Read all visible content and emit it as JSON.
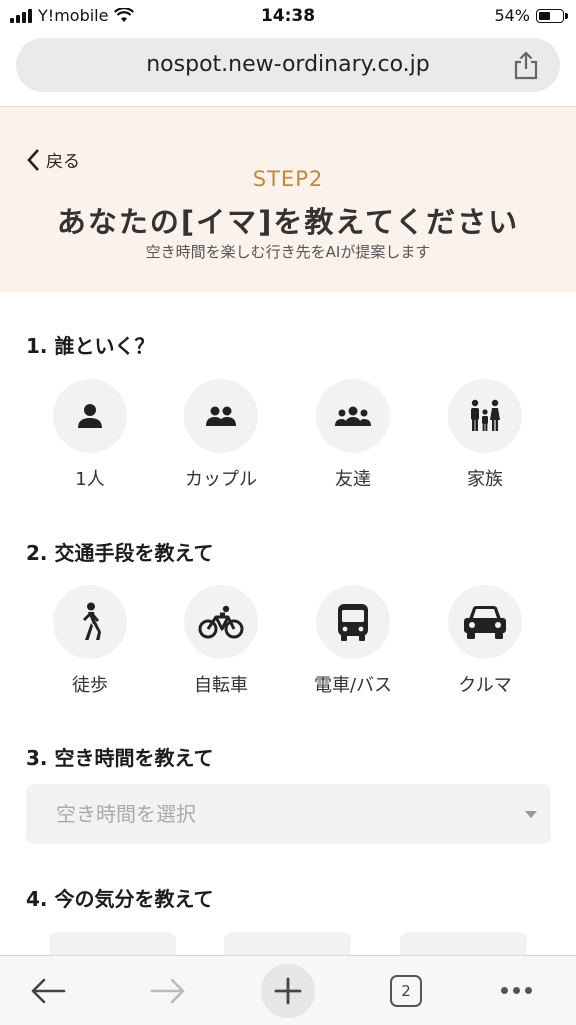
{
  "status": {
    "carrier": "Y!mobile",
    "time": "14:38",
    "battery": "54%",
    "battery_level": 0.54
  },
  "browser": {
    "url": "nospot.new-ordinary.co.jp",
    "tab_count": "2"
  },
  "header": {
    "back_label": "戻る",
    "step": "STEP2",
    "title": "あなたの[イマ]を教えてください",
    "subtitle": "空き時間を楽しむ行き先をAIが提案します"
  },
  "sections": {
    "who": {
      "title": "1. 誰といく？",
      "options": [
        {
          "label": "1人",
          "icon": "person-icon"
        },
        {
          "label": "カップル",
          "icon": "couple-icon"
        },
        {
          "label": "友達",
          "icon": "group-icon"
        },
        {
          "label": "家族",
          "icon": "family-icon"
        }
      ]
    },
    "transport": {
      "title": "2. 交通手段を教えて",
      "options": [
        {
          "label": "徒歩",
          "icon": "walk-icon"
        },
        {
          "label": "自転車",
          "icon": "bicycle-icon"
        },
        {
          "label": "電車/バス",
          "icon": "bus-icon"
        },
        {
          "label": "クルマ",
          "icon": "car-icon"
        }
      ]
    },
    "time": {
      "title": "3. 空き時間を教えて",
      "placeholder": "空き時間を選択"
    },
    "mood": {
      "title": "4. 今の気分を教えて"
    }
  }
}
